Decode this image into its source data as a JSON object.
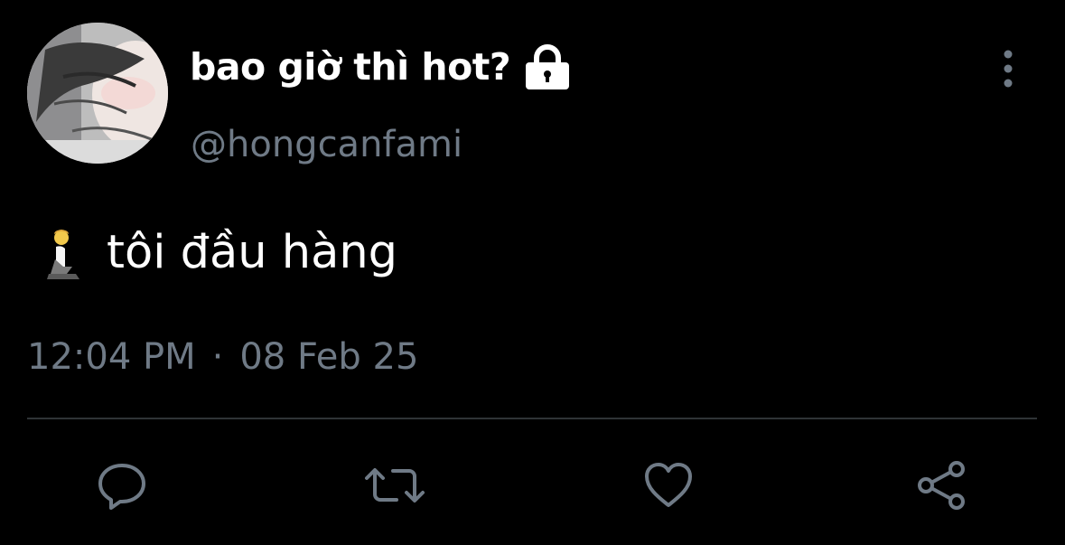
{
  "tweet": {
    "author": {
      "display_name": "bao giờ thì hot?",
      "handle": "@hongcanfami",
      "protected_icon": "lock-icon",
      "avatar": "avatar"
    },
    "text": "tôi đầu hàng",
    "emoji": "person-kneeling-icon",
    "time": "12:04 PM",
    "separator": "·",
    "date": "08 Feb 25",
    "actions": [
      "reply-icon",
      "retweet-icon",
      "like-icon",
      "share-icon"
    ],
    "more_icon": "more-vertical-icon"
  },
  "colors": {
    "background": "#000000",
    "text": "#ffffff",
    "secondary": "#6f7a86",
    "divider": "#2f3336"
  }
}
